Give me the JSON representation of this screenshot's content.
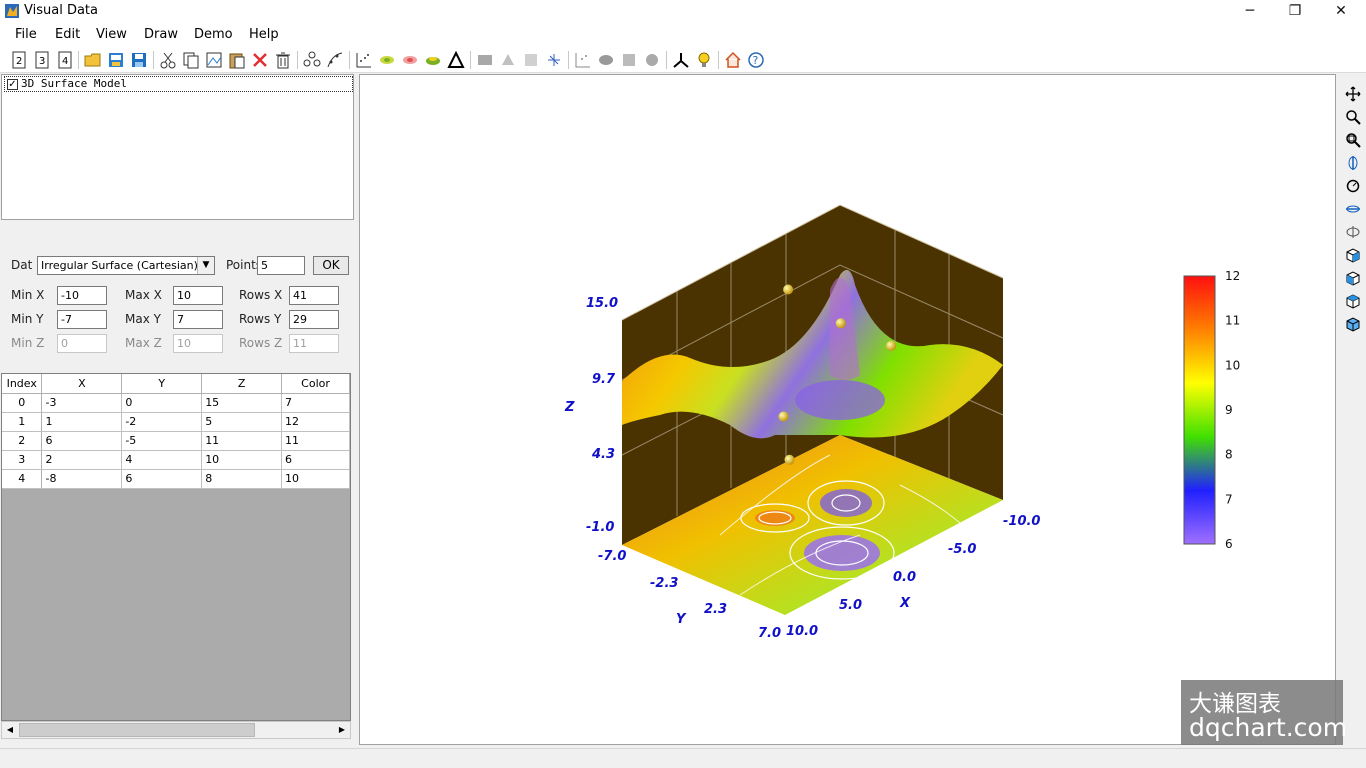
{
  "window": {
    "title": "Visual Data",
    "minimize": "─",
    "restore": "❐",
    "close": "✕"
  },
  "menu": [
    "File",
    "Edit",
    "View",
    "Draw",
    "Demo",
    "Help"
  ],
  "tree": {
    "item_label": "3D Surface Model",
    "checked": "✓"
  },
  "params": {
    "dat_label": "Dat",
    "dat_value": "Irregular Surface (Cartesian)",
    "points_label": "Points",
    "points_value": "5",
    "ok_label": "OK",
    "min_x_label": "Min X",
    "min_x": "-10",
    "max_x_label": "Max X",
    "max_x": "10",
    "rows_x_label": "Rows X",
    "rows_x": "41",
    "min_y_label": "Min Y",
    "min_y": "-7",
    "max_y_label": "Max Y",
    "max_y": "7",
    "rows_y_label": "Rows Y",
    "rows_y": "29",
    "min_z_label": "Min Z",
    "min_z": "0",
    "max_z_label": "Max Z",
    "max_z": "10",
    "rows_z_label": "Rows Z",
    "rows_z": "11"
  },
  "table": {
    "headers": [
      "Index",
      "X",
      "Y",
      "Z",
      "Color"
    ],
    "rows": [
      [
        "0",
        "-3",
        "0",
        "15",
        "7"
      ],
      [
        "1",
        "1",
        "-2",
        "5",
        "12"
      ],
      [
        "2",
        "6",
        "-5",
        "11",
        "11"
      ],
      [
        "3",
        "2",
        "4",
        "10",
        "6"
      ],
      [
        "4",
        "-8",
        "6",
        "8",
        "10"
      ]
    ]
  },
  "chart": {
    "z_axis_label": "Z",
    "x_axis_label": "X",
    "y_axis_label": "Y",
    "z_ticks": [
      "15.0",
      "9.7",
      "4.3",
      "-1.0"
    ],
    "x_ticks": [
      "-10.0",
      "-5.0",
      "0.0",
      "5.0",
      "10.0"
    ],
    "y_ticks": [
      "-7.0",
      "-2.3",
      "2.3",
      "7.0"
    ],
    "legend_ticks": [
      "12",
      "11",
      "10",
      "9",
      "8",
      "7",
      "6"
    ],
    "colors": {
      "tick_text": "#1010c8",
      "wall": "#4a3300",
      "wall_grid": "#9a8a6a"
    }
  },
  "chart_data": {
    "type": "scatter",
    "chart_kind": "3d-irregular-surface-with-contour",
    "x": [
      -3,
      1,
      6,
      2,
      -8
    ],
    "y": [
      0,
      -2,
      -5,
      4,
      6
    ],
    "z": [
      15,
      5,
      11,
      10,
      8
    ],
    "color_values": [
      7,
      12,
      11,
      6,
      10
    ],
    "xlim": [
      -10,
      10
    ],
    "ylim": [
      -7,
      7
    ],
    "zlim": [
      -1,
      15
    ],
    "colorbar_range": [
      6,
      12
    ],
    "xlabel": "X",
    "ylabel": "Y",
    "zlabel": "Z"
  },
  "watermark": {
    "cn": "大谦图表",
    "en": "dqchart.com"
  }
}
